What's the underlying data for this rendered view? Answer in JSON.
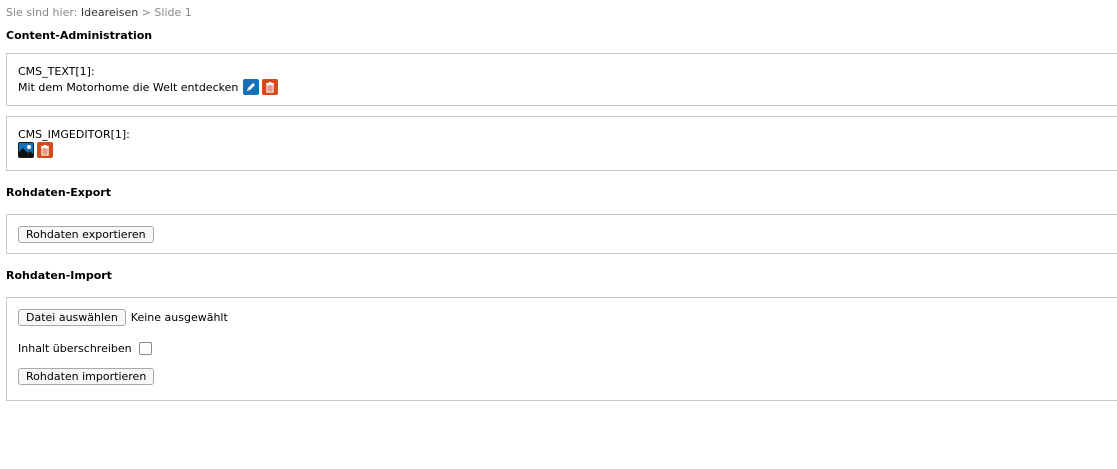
{
  "breadcrumb": {
    "prefix": "Sie sind hier:",
    "link": "Ideareisen",
    "separator": ">",
    "current": "Slide 1"
  },
  "content_admin": {
    "heading": "Content-Administration",
    "text_block": {
      "label": "CMS_TEXT[1]:",
      "value": "Mit dem Motorhome die Welt entdecken",
      "icons": [
        "edit-icon",
        "delete-icon"
      ]
    },
    "image_block": {
      "label": "CMS_IMGEDITOR[1]:",
      "icons": [
        "image-icon",
        "delete-icon"
      ]
    }
  },
  "export": {
    "heading": "Rohdaten-Export",
    "button_label": "Rohdaten exportieren"
  },
  "import": {
    "heading": "Rohdaten-Import",
    "file_button_label": "Datei auswählen",
    "file_status": "Keine ausgewählt",
    "overwrite_label": "Inhalt überschreiben",
    "overwrite_checked": false,
    "button_label": "Rohdaten importieren"
  },
  "colors": {
    "edit_icon": "#1a6fb5",
    "delete_icon": "#d24b1c",
    "border": "#c9c9c9"
  }
}
